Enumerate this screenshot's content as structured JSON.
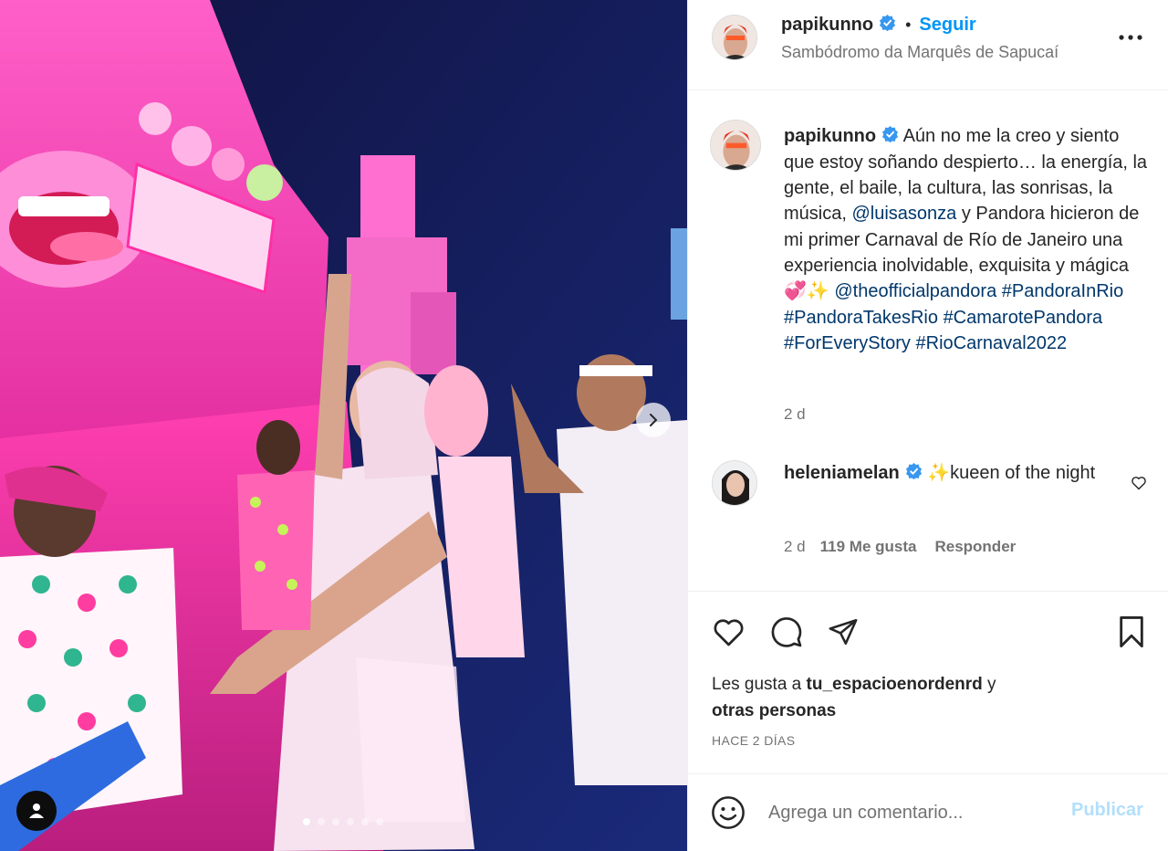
{
  "post": {
    "author": "papikunno",
    "verified": true,
    "separator": "•",
    "follow_label": "Seguir",
    "location": "Sambódromo da Marquês de Sapucaí",
    "more_icon": "more-horizontal-icon"
  },
  "caption": {
    "author": "papikunno",
    "text_1": "Aún no me la creo y siento que estoy soñando despierto… la energía, la gente, el baile, la cultura, las sonrisas, la música, ",
    "mention_1": "@luisasonza",
    "text_2": " y Pandora hicieron de mi primer Carnaval de Río de Janeiro una experiencia inolvidable, exquisita y mágica💞✨ ",
    "mention_2": "@theofficialpandora",
    "hashtags": [
      "#PandoraInRio",
      "#PandoraTakesRio",
      "#CamarotePandora",
      "#ForEveryStory",
      "#RioCarnaval2022"
    ],
    "time": "2 d"
  },
  "comments": [
    {
      "author": "heleniamelan",
      "verified": true,
      "text": "✨kueen of the night",
      "time": "2 d",
      "likes": "119 Me gusta",
      "reply_label": "Responder"
    }
  ],
  "likes": {
    "prefix": "Les gusta a ",
    "user": "tu_espacioenordenrd",
    "mid": " y",
    "others": "otras personas"
  },
  "date_label": "HACE 2 DÍAS",
  "composer": {
    "placeholder": "Agrega un comentario...",
    "publish_label": "Publicar"
  },
  "carousel": {
    "total": 6,
    "active": 1
  },
  "colors": {
    "link": "#00376b",
    "accent": "#0095f6",
    "verified": "#3897f0",
    "publish_disabled": "#b2dffc",
    "muted": "#737373"
  }
}
